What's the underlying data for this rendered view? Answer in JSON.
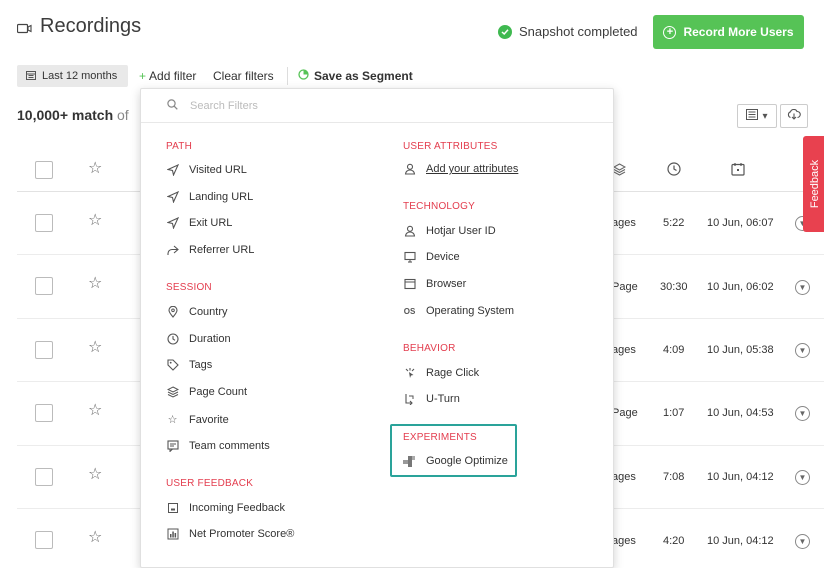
{
  "header": {
    "title": "Recordings",
    "snapshot_status": "Snapshot completed",
    "record_button": "Record More Users"
  },
  "filter_bar": {
    "date_range": "Last 12 months",
    "add_filter": "Add filter",
    "clear_filters": "Clear filters",
    "save_segment": "Save as Segment"
  },
  "results": {
    "count": "10,000+ match",
    "of": "of"
  },
  "feedback_tab": "Feedback",
  "table": {
    "rows": [
      {
        "pages": "ages",
        "duration": "5:22",
        "date": "10 Jun, 06:07"
      },
      {
        "pages": "Page",
        "duration": "30:30",
        "date": "10 Jun, 06:02"
      },
      {
        "pages": "ages",
        "duration": "4:09",
        "date": "10 Jun, 05:38"
      },
      {
        "pages": "Page",
        "duration": "1:07",
        "date": "10 Jun, 04:53"
      },
      {
        "pages": "ages",
        "duration": "7:08",
        "date": "10 Jun, 04:12"
      },
      {
        "pages": "ages",
        "duration": "4:20",
        "date": "10 Jun, 04:12"
      }
    ]
  },
  "dropdown": {
    "search_placeholder": "Search Filters",
    "left": {
      "path": {
        "title": "PATH",
        "items": [
          "Visited URL",
          "Landing URL",
          "Exit URL",
          "Referrer URL"
        ]
      },
      "session": {
        "title": "SESSION",
        "items": [
          "Country",
          "Duration",
          "Tags",
          "Page Count",
          "Favorite",
          "Team comments"
        ]
      },
      "user_feedback": {
        "title": "USER FEEDBACK",
        "items": [
          "Incoming Feedback",
          "Net Promoter Score®"
        ]
      }
    },
    "right": {
      "user_attributes": {
        "title": "USER ATTRIBUTES",
        "items": [
          "Add your attributes"
        ]
      },
      "technology": {
        "title": "TECHNOLOGY",
        "items": [
          "Hotjar User ID",
          "Device",
          "Browser",
          "Operating System"
        ]
      },
      "behavior": {
        "title": "BEHAVIOR",
        "items": [
          "Rage Click",
          "U-Turn"
        ]
      },
      "experiments": {
        "title": "EXPERIMENTS",
        "items": [
          "Google Optimize"
        ]
      }
    }
  },
  "colors": {
    "accent_green": "#56c356",
    "section_red": "#e33d4e",
    "highlight_teal": "#2aa39a",
    "feedback_red": "#e8414f"
  }
}
